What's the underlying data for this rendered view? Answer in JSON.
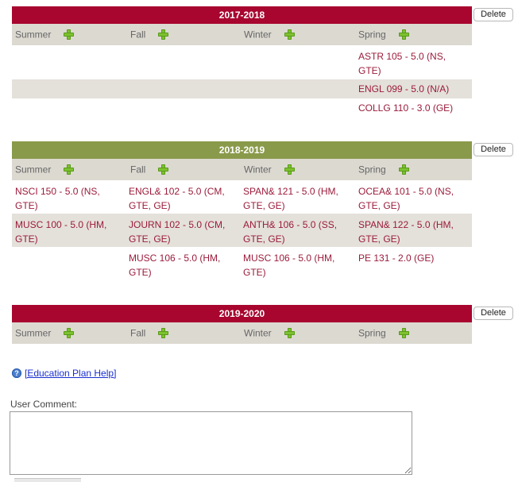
{
  "delete_label": "Delete",
  "colors": {
    "red_header": "#a8062f",
    "green_header": "#8a9a4b",
    "course_text": "#9b1b3b"
  },
  "icons": {
    "add": "plus-icon",
    "help": "help-icon"
  },
  "years": [
    {
      "label": "2017-2018",
      "terms": [
        "Summer",
        "Fall",
        "Winter",
        "Spring"
      ],
      "course_rows": [
        [
          "",
          "",
          "",
          "ASTR 105 - 5.0 (NS, GTE)"
        ],
        [
          "",
          "",
          "",
          "ENGL 099 - 5.0 (N/A)"
        ],
        [
          "",
          "",
          "",
          "COLLG 110 - 3.0 (GE)"
        ]
      ]
    },
    {
      "label": "2018-2019",
      "terms": [
        "Summer",
        "Fall",
        "Winter",
        "Spring"
      ],
      "course_rows": [
        [
          "NSCI 150 - 5.0 (NS, GTE)",
          "ENGL& 102 - 5.0 (CM, GTE, GE)",
          "SPAN& 121 - 5.0 (HM, GTE, GE)",
          "OCEA& 101 - 5.0 (NS, GTE, GE)"
        ],
        [
          "MUSC 100 - 5.0 (HM, GTE)",
          "JOURN 102 - 5.0 (CM, GTE, GE)",
          "ANTH& 106 - 5.0 (SS, GTE, GE)",
          "SPAN& 122 - 5.0 (HM, GTE, GE)"
        ],
        [
          "",
          "MUSC 106 - 5.0 (HM, GTE)",
          "MUSC 106 - 5.0 (HM, GTE)",
          "PE 131 - 2.0 (GE)"
        ]
      ]
    },
    {
      "label": "2019-2020",
      "terms": [
        "Summer",
        "Fall",
        "Winter",
        "Spring"
      ],
      "course_rows": []
    }
  ],
  "help_link": "[Education Plan Help]",
  "comment": {
    "label": "User Comment:",
    "value": ""
  }
}
